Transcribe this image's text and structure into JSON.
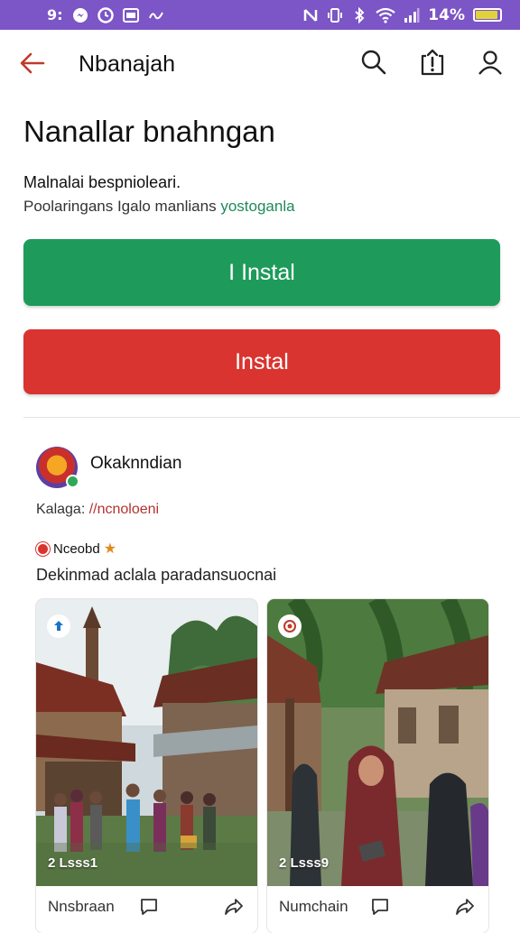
{
  "status_bar": {
    "battery_text": "14%",
    "bg_color": "#7c55c6"
  },
  "app_bar": {
    "title": "Nbanajah"
  },
  "page": {
    "heading": "Nanallar bnahngan",
    "subtitle": "Malnalai bespnioleari.",
    "description": "Poolaringans Igalo manlians",
    "description_highlight": "yostoganla"
  },
  "buttons": {
    "primary_label": "I Instal",
    "secondary_label": "Instal",
    "primary_color": "#1e9b5a",
    "secondary_color": "#d9342f"
  },
  "post": {
    "author": "Okaknndian",
    "meta_label": "Kalaga:",
    "meta_value": "//ncnoloeni",
    "tag": "Nceobd",
    "text": "Dekinmad aclala paradansuocnai"
  },
  "cards": [
    {
      "count": "2 Lsss1",
      "label": "Nnsbraan"
    },
    {
      "count": "2 Lsss9",
      "label": "Numchain"
    }
  ]
}
